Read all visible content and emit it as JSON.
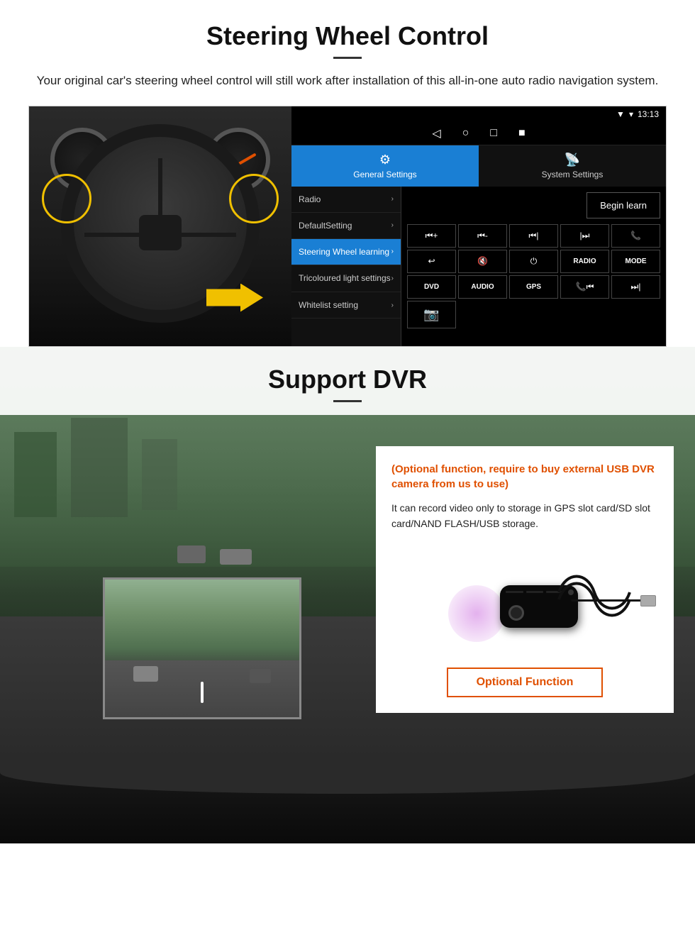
{
  "steering_section": {
    "title": "Steering Wheel Control",
    "description": "Your original car's steering wheel control will still work after installation of this all-in-one auto radio navigation system.",
    "android_ui": {
      "status_bar": {
        "signal": "▼",
        "wifi": "▾",
        "time": "13:13"
      },
      "nav_icons": [
        "◁",
        "○",
        "□",
        "■"
      ],
      "tabs": [
        {
          "id": "general",
          "icon": "⚙",
          "label": "General Settings",
          "active": true
        },
        {
          "id": "system",
          "icon": "⚡",
          "label": "System Settings",
          "active": false
        }
      ],
      "menu_items": [
        {
          "id": "radio",
          "label": "Radio",
          "active": false
        },
        {
          "id": "default",
          "label": "DefaultSetting",
          "active": false
        },
        {
          "id": "steering",
          "label": "Steering Wheel learning",
          "active": true
        },
        {
          "id": "tricolour",
          "label": "Tricoloured light settings",
          "active": false
        },
        {
          "id": "whitelist",
          "label": "Whitelist setting",
          "active": false
        }
      ],
      "begin_learn_label": "Begin learn",
      "control_buttons": [
        "⏮+",
        "⏮-",
        "⏮|",
        "⏭|",
        "📞",
        "↩",
        "🔇",
        "⏻",
        "RADIO",
        "MODE",
        "DVD",
        "AUDIO",
        "GPS",
        "📞⏮|",
        "⏭|"
      ]
    }
  },
  "dvr_section": {
    "title": "Support DVR",
    "optional_text": "(Optional function, require to buy external USB DVR camera from us to use)",
    "description": "It can record video only to storage in GPS slot card/SD slot card/NAND FLASH/USB storage.",
    "optional_button_label": "Optional Function"
  }
}
